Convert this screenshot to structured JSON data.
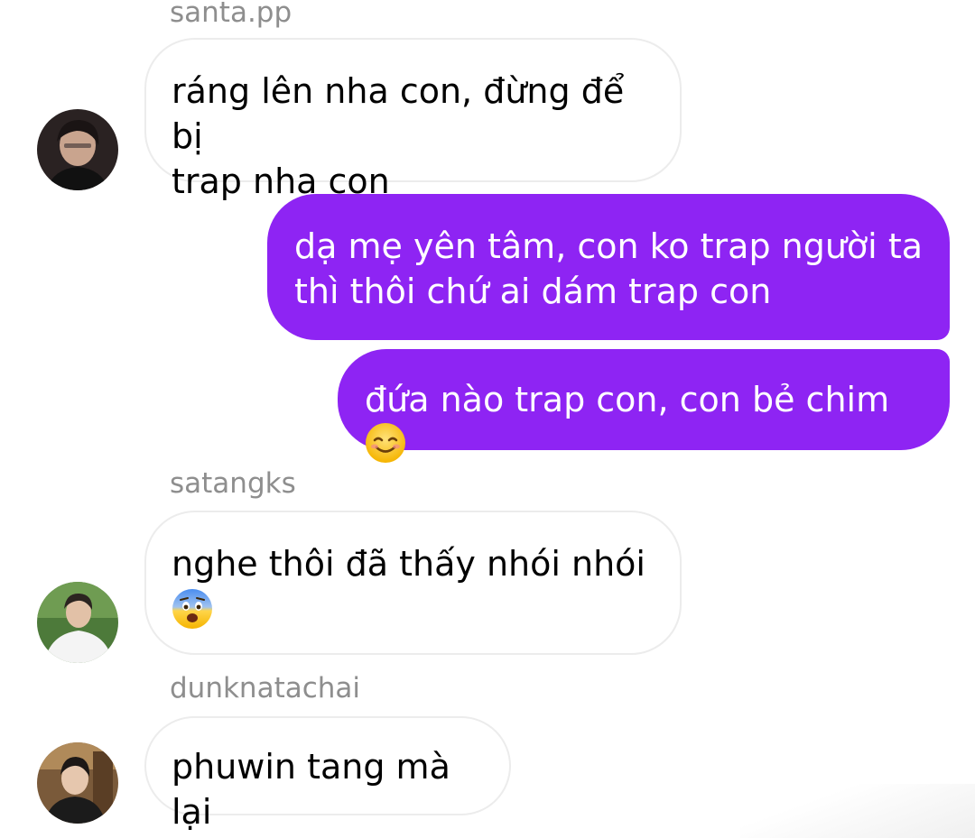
{
  "colors": {
    "outgoing_bubble": "#8e24f3",
    "incoming_border": "#ececec",
    "sender_name": "#8e8e8e"
  },
  "messages": [
    {
      "sender": "santa.pp",
      "direction": "incoming",
      "text": "ráng lên nha con, đừng để bị\ntrap nha con",
      "avatar": "avatar-santa"
    },
    {
      "direction": "outgoing",
      "text": "dạ mẹ yên tâm, con ko trap người ta\nthì thôi chứ ai dám trap con"
    },
    {
      "direction": "outgoing",
      "text": "đứa nào trap con, con bẻ chim ",
      "emoji": "smiling-face-emoji"
    },
    {
      "sender": "satangks",
      "direction": "incoming",
      "text": "nghe thôi đã thấy nhói nhói\n",
      "emoji": "anxious-face-emoji",
      "avatar": "avatar-satangks"
    },
    {
      "sender": "dunknatachai",
      "direction": "incoming",
      "text": "phuwin tang mà lại",
      "avatar": "avatar-dunknatachai"
    }
  ]
}
